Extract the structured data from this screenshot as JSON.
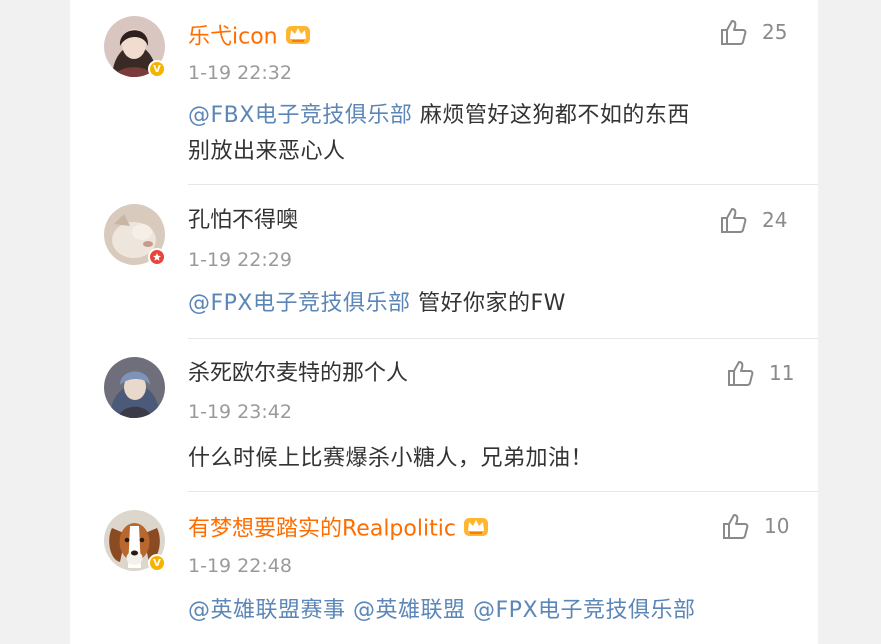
{
  "comments": [
    {
      "name": "乐弋icon",
      "time": "1-19 22:32",
      "likes": "25",
      "mention": "@FBX电子竞技俱乐部",
      "text_line1": " 麻烦管好这狗都不如的东西",
      "text_line2": "别放出来恶心人",
      "badge": "V"
    },
    {
      "name": "孔怕不得噢",
      "time": "1-19 22:29",
      "likes": "24",
      "mention": "@FPX电子竞技俱乐部",
      "text": " 管好你家的FW"
    },
    {
      "name": "杀死欧尔麦特的那个人",
      "time": "1-19 23:42",
      "likes": "11",
      "text": "什么时候上比赛爆杀小糖人，兄弟加油！"
    },
    {
      "name": "有梦想要踏实的Realpolitic",
      "time": "1-19 22:48",
      "likes": "10",
      "mentions": [
        "@英雄联盟赛事",
        "@英雄联盟",
        "@FPX电子竞技俱乐部"
      ],
      "badge": "V"
    }
  ],
  "colors": {
    "vip_name": "#ff6d00",
    "mention": "#5b86b7",
    "badge_gold": "#f5b300",
    "badge_red": "#e8443a"
  }
}
